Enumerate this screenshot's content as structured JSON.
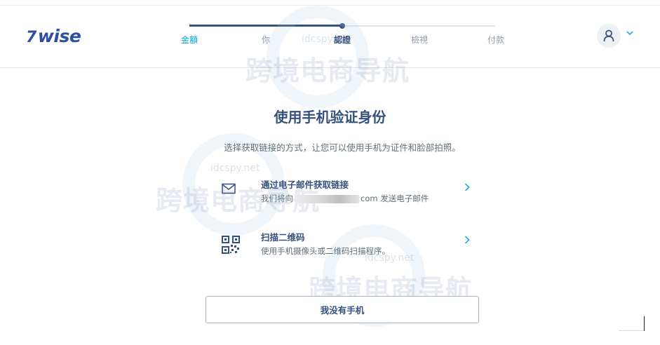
{
  "brand": {
    "logo_mark": "7",
    "logo_text": "wise"
  },
  "stepper": {
    "steps": [
      {
        "label": "金額",
        "state": "done"
      },
      {
        "label": "你",
        "state": "done"
      },
      {
        "label": "認證",
        "state": "current"
      },
      {
        "label": "檢視",
        "state": "todo"
      },
      {
        "label": "付款",
        "state": "todo"
      }
    ]
  },
  "user_menu": {
    "avatar_icon": "user-icon",
    "chevron_icon": "chevron-down-icon"
  },
  "page": {
    "title": "使用手机验证身份",
    "subtitle": "选择获取链接的方式，让您可以使用手机为证件和脸部拍照。"
  },
  "options": {
    "email": {
      "icon": "envelope-icon",
      "title": "通过电子邮件获取链接",
      "desc_prefix": "我们将向",
      "desc_suffix": "com 发送电子邮件"
    },
    "qr": {
      "icon": "qr-code-icon",
      "title": "扫描二维码",
      "desc": "使用手机摄像头或二维码扫描程序。"
    }
  },
  "no_phone_button": "我没有手机",
  "watermark": {
    "text": "跨境电商导航",
    "domain": "idcspy.net"
  },
  "colors": {
    "primary": "#37517e",
    "accent": "#00a2dd",
    "muted": "#5d7079",
    "border": "#a6b5c4"
  }
}
